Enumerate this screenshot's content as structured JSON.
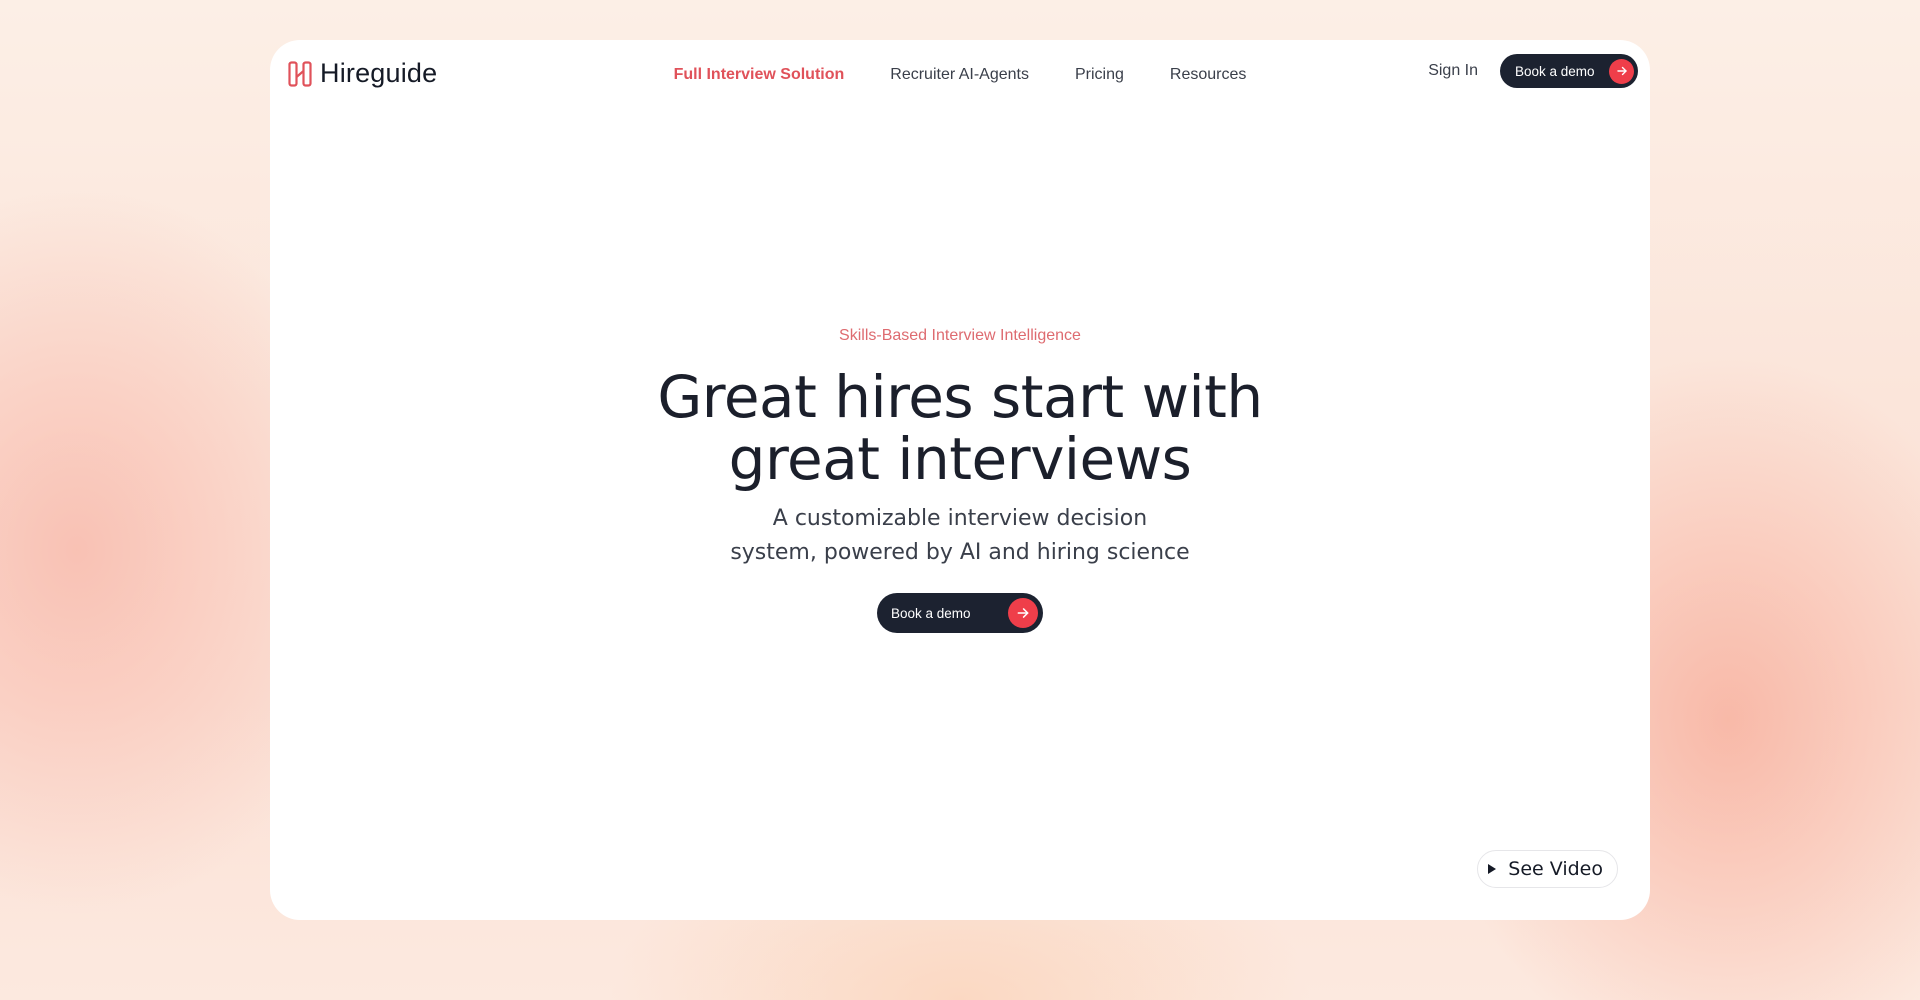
{
  "brand": {
    "name": "Hireguide",
    "accent_color": "#ef3e4a",
    "dark_color": "#1c2230"
  },
  "nav": {
    "links": [
      {
        "label": "Full Interview Solution",
        "active": true
      },
      {
        "label": "Recruiter AI-Agents",
        "active": false
      },
      {
        "label": "Pricing",
        "active": false
      },
      {
        "label": "Resources",
        "active": false
      }
    ],
    "sign_in": "Sign In",
    "cta": "Book a demo"
  },
  "hero": {
    "eyebrow": "Skills-Based Interview Intelligence",
    "headline_line1": "Great hires start with",
    "headline_line2": "great interviews",
    "subhead_line1": "A customizable interview decision",
    "subhead_line2": "system, powered by AI and hiring science",
    "cta": "Book a demo"
  },
  "video": {
    "label": "See Video",
    "icon": "play-icon"
  }
}
